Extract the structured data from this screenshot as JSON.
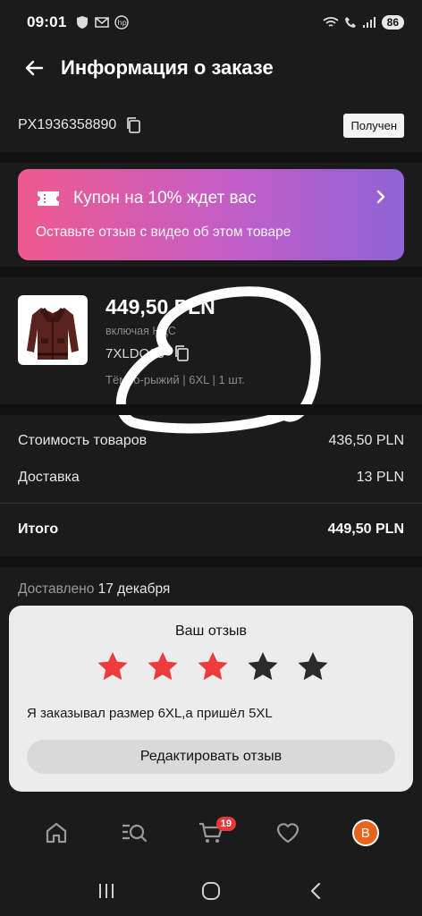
{
  "status_bar": {
    "time": "09:01",
    "battery": "86"
  },
  "header": {
    "title": "Информация о заказе"
  },
  "order": {
    "id": "PX1936358890",
    "status": "Получен"
  },
  "coupon": {
    "title": "Купон на 10% ждет вас",
    "subtitle": "Оставьте отзыв с видео об этом товаре"
  },
  "product": {
    "price": "449,50 PLN",
    "vat": "включая НДС",
    "sku": "7XLDQ25",
    "variant": "Тёмно-рыжий | 6XL | 1 шт."
  },
  "cost": {
    "goods_label": "Стоимость товаров",
    "goods_value": "436,50 PLN",
    "delivery_label": "Доставка",
    "delivery_value": "13 PLN",
    "total_label": "Итого",
    "total_value": "449,50 PLN"
  },
  "delivery": {
    "label": "Доставлено",
    "date": "17 декабря"
  },
  "review": {
    "title": "Ваш отзыв",
    "rating": 3,
    "max_rating": 5,
    "text": "Я заказывал размер 6XL,а пришёл 5XL",
    "edit_label": "Редактировать отзыв"
  },
  "bottom_nav": {
    "cart_count": "19",
    "profile_initial": "B"
  },
  "colors": {
    "accent_red": "#e43a3a",
    "coupon_start": "#ef5a8f",
    "coupon_end": "#8f63d6",
    "star_filled": "#ee3b3b",
    "star_empty": "#2b2b2b"
  }
}
